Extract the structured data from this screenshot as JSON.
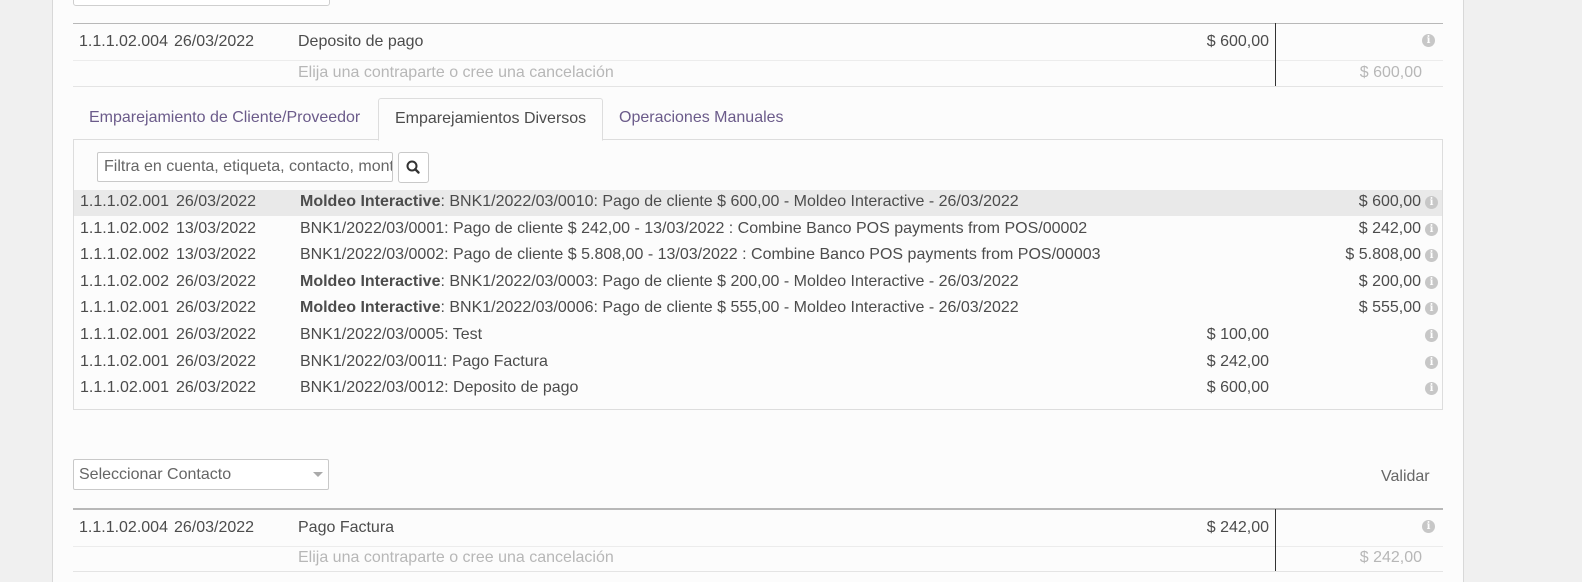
{
  "statement_lines": [
    {
      "account": "1.1.1.02.004",
      "date": "26/03/2022",
      "label": "Deposito de pago",
      "amount": "$ 600,00",
      "hint": "Elija una contraparte o cree una cancelación",
      "open_amount": "$ 600,00"
    },
    {
      "account": "1.1.1.02.004",
      "date": "26/03/2022",
      "label": "Pago Factura",
      "amount": "$ 242,00",
      "hint": "Elija una contraparte o cree una cancelación",
      "open_amount": "$ 242,00"
    }
  ],
  "tabs": [
    {
      "label": "Emparejamiento de Cliente/Proveedor",
      "active": false
    },
    {
      "label": "Emparejamientos Diversos",
      "active": true
    },
    {
      "label": "Operaciones Manuales",
      "active": false
    }
  ],
  "filter": {
    "placeholder": "Filtra en cuenta, etiqueta, contacto, monto"
  },
  "matches": [
    {
      "account": "1.1.1.02.001",
      "date": "26/03/2022",
      "partner": "Moldeo Interactive",
      "label": ": BNK1/2022/03/0010: Pago de cliente $ 600,00 - Moldeo Interactive - 26/03/2022",
      "debit": "",
      "credit": "$ 600,00",
      "highlighted": true
    },
    {
      "account": "1.1.1.02.002",
      "date": "13/03/2022",
      "partner": "",
      "label": "BNK1/2022/03/0001: Pago de cliente $ 242,00 - 13/03/2022 : Combine Banco POS payments from POS/00002",
      "debit": "",
      "credit": "$ 242,00",
      "highlighted": false
    },
    {
      "account": "1.1.1.02.002",
      "date": "13/03/2022",
      "partner": "",
      "label": "BNK1/2022/03/0002: Pago de cliente $ 5.808,00 - 13/03/2022 : Combine Banco POS payments from POS/00003",
      "debit": "",
      "credit": "$ 5.808,00",
      "highlighted": false
    },
    {
      "account": "1.1.1.02.002",
      "date": "26/03/2022",
      "partner": "Moldeo Interactive",
      "label": ": BNK1/2022/03/0003: Pago de cliente $ 200,00 - Moldeo Interactive - 26/03/2022",
      "debit": "",
      "credit": "$ 200,00",
      "highlighted": false
    },
    {
      "account": "1.1.1.02.001",
      "date": "26/03/2022",
      "partner": "Moldeo Interactive",
      "label": ": BNK1/2022/03/0006: Pago de cliente $ 555,00 - Moldeo Interactive - 26/03/2022",
      "debit": "",
      "credit": "$ 555,00",
      "highlighted": false
    },
    {
      "account": "1.1.1.02.001",
      "date": "26/03/2022",
      "partner": "",
      "label": "BNK1/2022/03/0005: Test",
      "debit": "$ 100,00",
      "credit": "",
      "highlighted": false
    },
    {
      "account": "1.1.1.02.001",
      "date": "26/03/2022",
      "partner": "",
      "label": "BNK1/2022/03/0011: Pago Factura",
      "debit": "$ 242,00",
      "credit": "",
      "highlighted": false
    },
    {
      "account": "1.1.1.02.001",
      "date": "26/03/2022",
      "partner": "",
      "label": "BNK1/2022/03/0012: Deposito de pago",
      "debit": "$ 600,00",
      "credit": "",
      "highlighted": false
    }
  ],
  "contact_select": {
    "placeholder": "Seleccionar Contacto"
  },
  "validate_label": "Validar",
  "icons": {
    "info": "info-circle-icon",
    "search": "search-icon",
    "caret": "chevron-down-icon"
  }
}
